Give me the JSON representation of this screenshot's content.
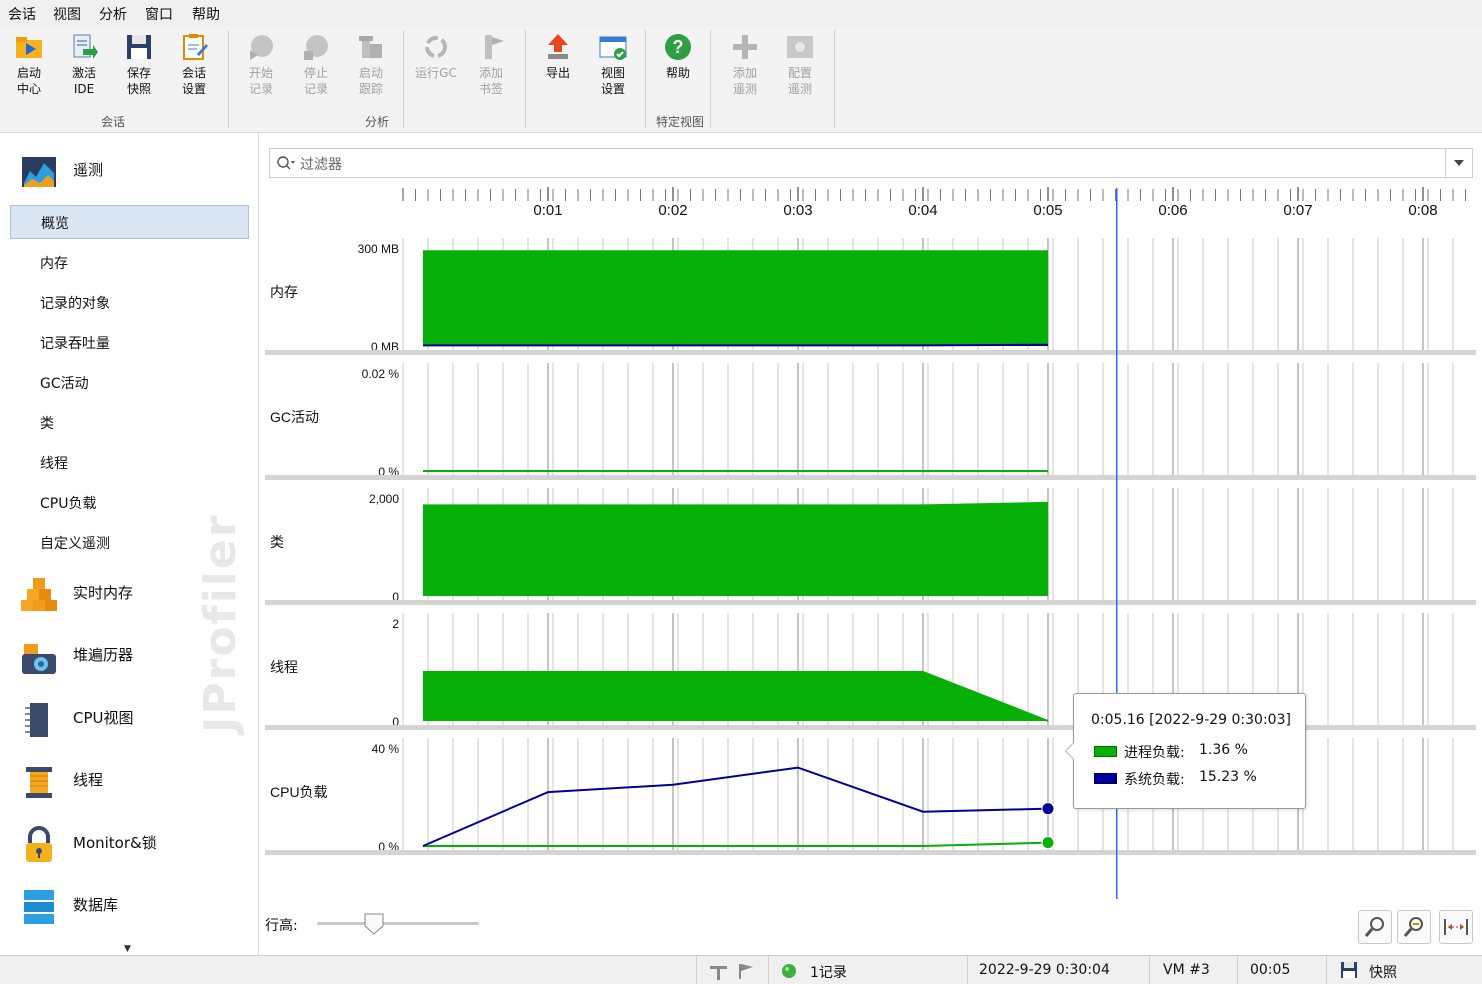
{
  "menu": [
    "会话",
    "视图",
    "分析",
    "窗口",
    "帮助"
  ],
  "ribbon": {
    "buttons": [
      {
        "id": "start-center",
        "line1": "启动",
        "line2": "中心",
        "disabled": false
      },
      {
        "id": "activate-ide",
        "line1": "激活",
        "line2": "IDE",
        "disabled": false
      },
      {
        "id": "save-snapshot",
        "line1": "保存",
        "line2": "快照",
        "disabled": false
      },
      {
        "id": "session-settings",
        "line1": "会话",
        "line2": "设置",
        "disabled": false
      },
      {
        "id": "start-recording",
        "line1": "开始",
        "line2": "记录",
        "disabled": true
      },
      {
        "id": "stop-recording",
        "line1": "停止",
        "line2": "记录",
        "disabled": true
      },
      {
        "id": "start-tracking",
        "line1": "启动",
        "line2": "跟踪",
        "disabled": true
      },
      {
        "id": "run-gc",
        "line1": "运行GC",
        "line2": "",
        "disabled": true
      },
      {
        "id": "add-bookmark",
        "line1": "添加",
        "line2": "书签",
        "disabled": true
      },
      {
        "id": "export",
        "line1": "导出",
        "line2": "",
        "disabled": false
      },
      {
        "id": "view-settings",
        "line1": "视图",
        "line2": "设置",
        "disabled": false
      },
      {
        "id": "help",
        "line1": "帮助",
        "line2": "",
        "disabled": false
      },
      {
        "id": "add-telemetry",
        "line1": "添加",
        "line2": "遥测",
        "disabled": true
      },
      {
        "id": "configure-telemetry",
        "line1": "配置",
        "line2": "遥测",
        "disabled": true
      }
    ],
    "groups": {
      "session": "会话",
      "analysis": "分析",
      "specific_view": "特定视图"
    }
  },
  "sidebar": {
    "telemetry_label": "遥测",
    "sub_items": [
      "概览",
      "内存",
      "记录的对象",
      "记录吞吐量",
      "GC活动",
      "类",
      "线程",
      "CPU负载",
      "自定义遥测"
    ],
    "active_sub": 0,
    "main_items": [
      "实时内存",
      "堆遍历器",
      "CPU视图",
      "线程",
      "Monitor&锁",
      "数据库"
    ],
    "watermark": "JProfiler"
  },
  "filter": {
    "placeholder": "过滤器"
  },
  "colors": {
    "green": "#06b006",
    "blue": "#000099",
    "cursor": "#3366ff"
  },
  "timeline": {
    "ticks": [
      "0:01",
      "0:02",
      "0:03",
      "0:04",
      "0:05",
      "0:06",
      "0:07",
      "0:08"
    ],
    "cursor_time": 5.55
  },
  "chart_data": [
    {
      "type": "area",
      "name": "内存",
      "ymax_label": "300 MB",
      "ymin_label": "0 MB",
      "ylim": [
        0,
        300
      ],
      "series": [
        {
          "name": "",
          "color": "#06b006",
          "x": [
            0,
            5
          ],
          "values": [
            290,
            290
          ]
        },
        {
          "name": "",
          "color": "#000099",
          "x": [
            0,
            4,
            5
          ],
          "values": [
            2,
            2,
            4
          ]
        }
      ]
    },
    {
      "type": "area",
      "name": "GC活动",
      "ymax_label": "0.02 %",
      "ymin_label": "0 %",
      "ylim": [
        0,
        0.02
      ],
      "series": [
        {
          "name": "",
          "color": "#06b006",
          "x": [
            0,
            5
          ],
          "values": [
            0,
            0
          ]
        }
      ]
    },
    {
      "type": "area",
      "name": "类",
      "ymax_label": "2,000",
      "ymin_label": "0",
      "ylim": [
        0,
        2000
      ],
      "series": [
        {
          "name": "",
          "color": "#06b006",
          "x": [
            0,
            4,
            5
          ],
          "values": [
            1850,
            1850,
            1900
          ]
        }
      ]
    },
    {
      "type": "area",
      "name": "线程",
      "ymax_label": "2",
      "ymin_label": "0",
      "ylim": [
        0,
        2
      ],
      "series": [
        {
          "name": "",
          "color": "#06b006",
          "x": [
            0,
            4,
            5
          ],
          "values": [
            1,
            1,
            0
          ]
        }
      ]
    },
    {
      "type": "line",
      "name": "CPU负载",
      "ymax_label": "40 %",
      "ymin_label": "0 %",
      "ylim": [
        0,
        40
      ],
      "series": [
        {
          "name": "进程负载",
          "color": "#06b006",
          "x": [
            0,
            1,
            2,
            3,
            4,
            5
          ],
          "values": [
            0,
            0,
            0,
            0,
            0,
            1.36
          ]
        },
        {
          "name": "系统负载",
          "color": "#000099",
          "x": [
            0,
            1,
            2,
            3,
            4,
            5
          ],
          "values": [
            0,
            22,
            25,
            32,
            14,
            15.23
          ]
        }
      ]
    }
  ],
  "tooltip": {
    "header": "0:05.16 [2022-9-29 0:30:03]",
    "rows": [
      {
        "label": "进程负载:",
        "value": "1.36 %"
      },
      {
        "label": "系统负载:",
        "value": "15.23 %"
      }
    ]
  },
  "row_height_label": "行高:",
  "row_height_value": 0.35,
  "statusbar": {
    "recordings": "1记录",
    "datetime": "2022-9-29 0:30:04",
    "vm": "VM #3",
    "elapsed": "00:05",
    "snapshot": "快照"
  }
}
